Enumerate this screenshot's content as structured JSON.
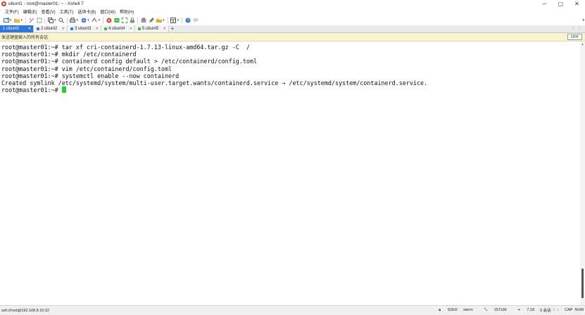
{
  "window": {
    "title": "ubunt1 - root@master01: ~ - Xshell 7",
    "controls": {
      "minimize": "─",
      "maximize": "▢",
      "close": "✕"
    }
  },
  "menu": {
    "items": [
      "文件(F)",
      "编辑(E)",
      "查看(V)",
      "工具(T)",
      "选项卡(B)",
      "窗口(W)",
      "帮助(H)"
    ]
  },
  "toolbar": {
    "icons": [
      "new-session-icon",
      "open-folder-icon",
      "disconnect-icon",
      "properties-icon",
      "copy-icon",
      "search-icon",
      "print-icon",
      "globe-icon",
      "keyboard-icon",
      "xftp-icon",
      "transfer-icon",
      "fullscreen-icon",
      "lock-icon",
      "script-icon",
      "compose-icon",
      "layout-icon",
      "help-icon",
      "chat-icon"
    ]
  },
  "tabs": [
    {
      "label": "1 ubunt1",
      "active": true,
      "dot_color": "#2f78d6"
    },
    {
      "label": "2 ubunt2",
      "active": false,
      "dot_color": "#2f78d6"
    },
    {
      "label": "3 ubunt3",
      "active": false,
      "dot_color": "#2f78d6"
    },
    {
      "label": "4 ubunt4",
      "active": false,
      "dot_color": "#3cb043"
    },
    {
      "label": "5 ubunt5",
      "active": false,
      "dot_color": "#3cb043"
    }
  ],
  "tabbar": {
    "add_label": "+",
    "nav_label": "‹ ›"
  },
  "compose": {
    "text": "发送键盘输入的所有会话",
    "off_label": "OFF"
  },
  "terminal": {
    "lines": [
      "root@master01:~# tar xf cri-containerd-1.7.13-linux-amd64.tar.gz -C  /",
      "root@master01:~# mkdir /etc/containerd",
      "root@master01:~# containerd config default > /etc/containerd/config.toml",
      "root@master01:~# vim /etc/containerd/config.toml",
      "root@master01:~# systemctl enable --now containerd",
      "Created symlink /etc/systemd/system/multi-user.target.wants/containerd.service → /etc/systemd/system/containerd.service."
    ],
    "prompt": "root@master01:~# ",
    "cursor_color": "#22d13a"
  },
  "status": {
    "connection": "ssh://root@192.168.8.10:22",
    "protocol": "SSH2",
    "terminal_type": "xterm",
    "size": "157x36",
    "cursor_pos": "7,18",
    "sessions": "5 会话",
    "caps": "CAP",
    "num": "NUM"
  },
  "colors": {
    "active_tab": "#2f78d6",
    "compose_bg": "#faf3cf",
    "cursor": "#22d13a"
  }
}
